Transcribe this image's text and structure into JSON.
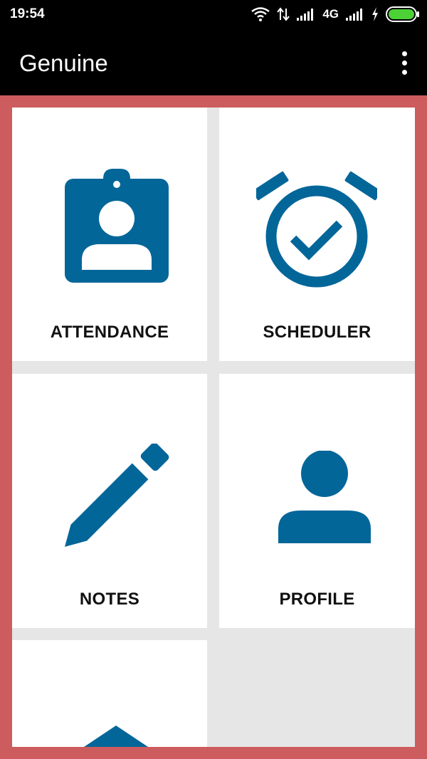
{
  "status_bar": {
    "time": "19:54",
    "network": "4G",
    "icons": [
      "wifi-icon",
      "data-transfer-icon",
      "signal-icon",
      "signal-icon",
      "charging-icon",
      "battery-icon"
    ]
  },
  "app_bar": {
    "title": "Genuine",
    "menu_icon": "overflow-menu-icon"
  },
  "colors": {
    "accent": "#036699",
    "frame": "#cd5c5e",
    "tile_bg": "#ffffff",
    "grid_bg": "#e6e6e6"
  },
  "tiles": [
    {
      "label": "ATTENDANCE",
      "icon": "badge-icon"
    },
    {
      "label": "SCHEDULER",
      "icon": "alarm-check-icon"
    },
    {
      "label": "NOTES",
      "icon": "pencil-icon"
    },
    {
      "label": "PROFILE",
      "icon": "person-icon"
    },
    {
      "label": "",
      "icon": "home-icon"
    }
  ]
}
